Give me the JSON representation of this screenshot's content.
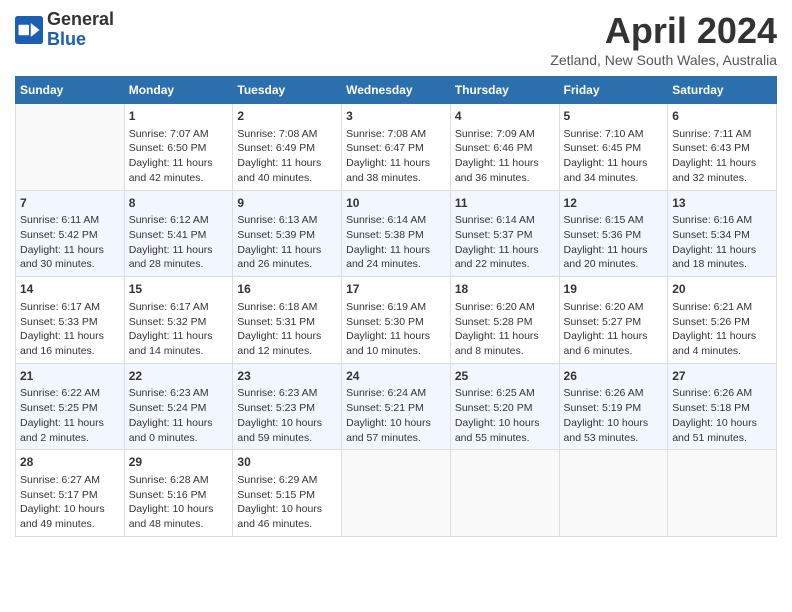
{
  "logo": {
    "text_general": "General",
    "text_blue": "Blue"
  },
  "title": "April 2024",
  "location": "Zetland, New South Wales, Australia",
  "days_of_week": [
    "Sunday",
    "Monday",
    "Tuesday",
    "Wednesday",
    "Thursday",
    "Friday",
    "Saturday"
  ],
  "weeks": [
    [
      {
        "day": "",
        "content": ""
      },
      {
        "day": "1",
        "content": "Sunrise: 7:07 AM\nSunset: 6:50 PM\nDaylight: 11 hours\nand 42 minutes."
      },
      {
        "day": "2",
        "content": "Sunrise: 7:08 AM\nSunset: 6:49 PM\nDaylight: 11 hours\nand 40 minutes."
      },
      {
        "day": "3",
        "content": "Sunrise: 7:08 AM\nSunset: 6:47 PM\nDaylight: 11 hours\nand 38 minutes."
      },
      {
        "day": "4",
        "content": "Sunrise: 7:09 AM\nSunset: 6:46 PM\nDaylight: 11 hours\nand 36 minutes."
      },
      {
        "day": "5",
        "content": "Sunrise: 7:10 AM\nSunset: 6:45 PM\nDaylight: 11 hours\nand 34 minutes."
      },
      {
        "day": "6",
        "content": "Sunrise: 7:11 AM\nSunset: 6:43 PM\nDaylight: 11 hours\nand 32 minutes."
      }
    ],
    [
      {
        "day": "7",
        "content": "Sunrise: 6:11 AM\nSunset: 5:42 PM\nDaylight: 11 hours\nand 30 minutes."
      },
      {
        "day": "8",
        "content": "Sunrise: 6:12 AM\nSunset: 5:41 PM\nDaylight: 11 hours\nand 28 minutes."
      },
      {
        "day": "9",
        "content": "Sunrise: 6:13 AM\nSunset: 5:39 PM\nDaylight: 11 hours\nand 26 minutes."
      },
      {
        "day": "10",
        "content": "Sunrise: 6:14 AM\nSunset: 5:38 PM\nDaylight: 11 hours\nand 24 minutes."
      },
      {
        "day": "11",
        "content": "Sunrise: 6:14 AM\nSunset: 5:37 PM\nDaylight: 11 hours\nand 22 minutes."
      },
      {
        "day": "12",
        "content": "Sunrise: 6:15 AM\nSunset: 5:36 PM\nDaylight: 11 hours\nand 20 minutes."
      },
      {
        "day": "13",
        "content": "Sunrise: 6:16 AM\nSunset: 5:34 PM\nDaylight: 11 hours\nand 18 minutes."
      }
    ],
    [
      {
        "day": "14",
        "content": "Sunrise: 6:17 AM\nSunset: 5:33 PM\nDaylight: 11 hours\nand 16 minutes."
      },
      {
        "day": "15",
        "content": "Sunrise: 6:17 AM\nSunset: 5:32 PM\nDaylight: 11 hours\nand 14 minutes."
      },
      {
        "day": "16",
        "content": "Sunrise: 6:18 AM\nSunset: 5:31 PM\nDaylight: 11 hours\nand 12 minutes."
      },
      {
        "day": "17",
        "content": "Sunrise: 6:19 AM\nSunset: 5:30 PM\nDaylight: 11 hours\nand 10 minutes."
      },
      {
        "day": "18",
        "content": "Sunrise: 6:20 AM\nSunset: 5:28 PM\nDaylight: 11 hours\nand 8 minutes."
      },
      {
        "day": "19",
        "content": "Sunrise: 6:20 AM\nSunset: 5:27 PM\nDaylight: 11 hours\nand 6 minutes."
      },
      {
        "day": "20",
        "content": "Sunrise: 6:21 AM\nSunset: 5:26 PM\nDaylight: 11 hours\nand 4 minutes."
      }
    ],
    [
      {
        "day": "21",
        "content": "Sunrise: 6:22 AM\nSunset: 5:25 PM\nDaylight: 11 hours\nand 2 minutes."
      },
      {
        "day": "22",
        "content": "Sunrise: 6:23 AM\nSunset: 5:24 PM\nDaylight: 11 hours\nand 0 minutes."
      },
      {
        "day": "23",
        "content": "Sunrise: 6:23 AM\nSunset: 5:23 PM\nDaylight: 10 hours\nand 59 minutes."
      },
      {
        "day": "24",
        "content": "Sunrise: 6:24 AM\nSunset: 5:21 PM\nDaylight: 10 hours\nand 57 minutes."
      },
      {
        "day": "25",
        "content": "Sunrise: 6:25 AM\nSunset: 5:20 PM\nDaylight: 10 hours\nand 55 minutes."
      },
      {
        "day": "26",
        "content": "Sunrise: 6:26 AM\nSunset: 5:19 PM\nDaylight: 10 hours\nand 53 minutes."
      },
      {
        "day": "27",
        "content": "Sunrise: 6:26 AM\nSunset: 5:18 PM\nDaylight: 10 hours\nand 51 minutes."
      }
    ],
    [
      {
        "day": "28",
        "content": "Sunrise: 6:27 AM\nSunset: 5:17 PM\nDaylight: 10 hours\nand 49 minutes."
      },
      {
        "day": "29",
        "content": "Sunrise: 6:28 AM\nSunset: 5:16 PM\nDaylight: 10 hours\nand 48 minutes."
      },
      {
        "day": "30",
        "content": "Sunrise: 6:29 AM\nSunset: 5:15 PM\nDaylight: 10 hours\nand 46 minutes."
      },
      {
        "day": "",
        "content": ""
      },
      {
        "day": "",
        "content": ""
      },
      {
        "day": "",
        "content": ""
      },
      {
        "day": "",
        "content": ""
      }
    ]
  ]
}
